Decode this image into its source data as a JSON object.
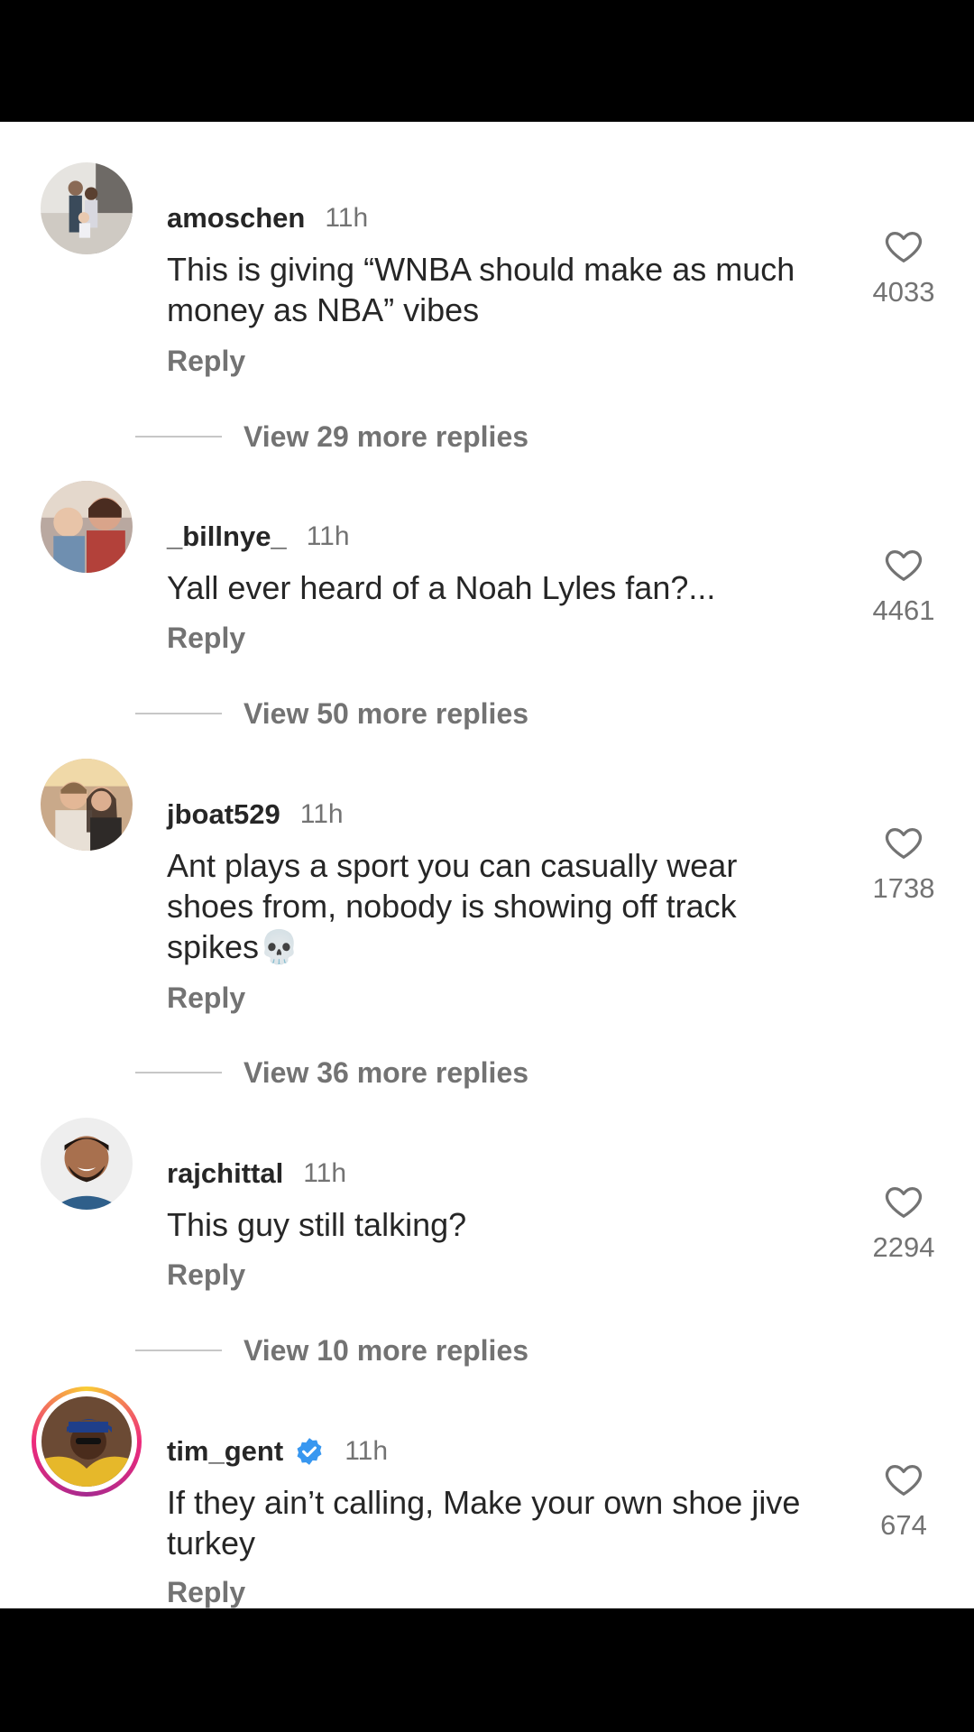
{
  "comments": [
    {
      "username": "amoschen",
      "time": "11h",
      "text": "This is giving “WNBA should make as much money as NBA” vibes",
      "reply_label": "Reply",
      "likes": "4033",
      "view_replies": "View 29 more replies",
      "avatar": "family-photo-avatar"
    },
    {
      "username": "_billnye_",
      "time": "11h",
      "text": "Yall ever heard of a Noah Lyles fan?...",
      "reply_label": "Reply",
      "likes": "4461",
      "view_replies": "View 50 more replies",
      "avatar": "two-people-photo-avatar"
    },
    {
      "username": "jboat529",
      "time": "11h",
      "text": "Ant plays a sport you can casually wear shoes from, nobody is showing off track spikes💀",
      "reply_label": "Reply",
      "likes": "1738",
      "view_replies": "View 36 more replies",
      "avatar": "couple-photo-avatar"
    },
    {
      "username": "rajchittal",
      "time": "11h",
      "text": "This guy still talking?",
      "reply_label": "Reply",
      "likes": "2294",
      "view_replies": "View 10 more replies",
      "avatar": "smiling-man-avatar"
    },
    {
      "username": "tim_gent",
      "time": "11h",
      "text": "If they ain’t calling, Make your own shoe jive turkey",
      "reply_label": "Reply",
      "likes": "674",
      "verified": true,
      "avatar": "story-ring-avatar"
    }
  ],
  "colors": {
    "verified_badge": "#3897f0",
    "text_primary": "#262626",
    "text_secondary": "#737373"
  }
}
